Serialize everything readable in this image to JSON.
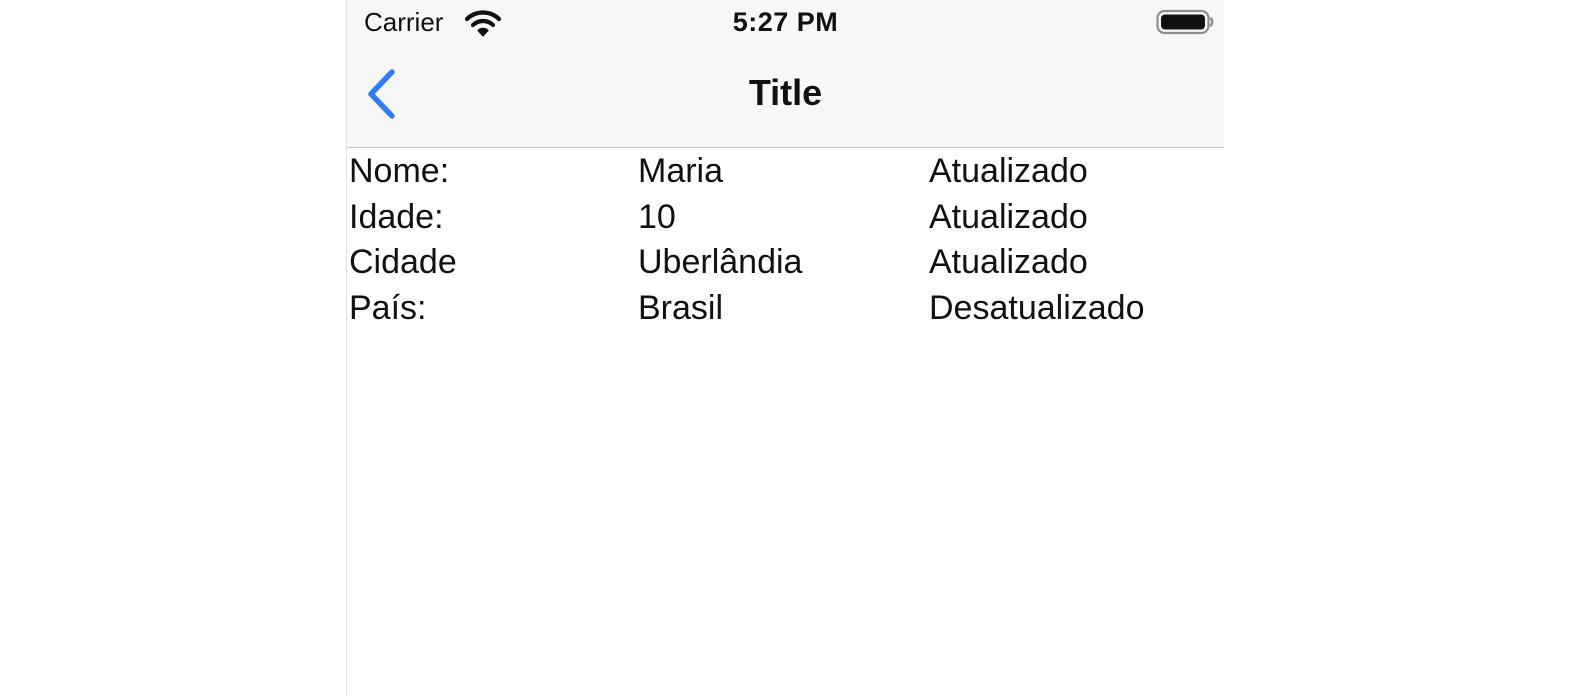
{
  "status_bar": {
    "carrier": "Carrier",
    "time": "5:27 PM",
    "wifi_icon": "wifi-icon",
    "battery_icon": "battery-full-icon"
  },
  "nav_bar": {
    "title": "Title",
    "back_icon": "chevron-left-icon",
    "accent_color": "#2f7cf6",
    "background_color": "#f7f7f7"
  },
  "rows": [
    {
      "label": "Nome:",
      "value": "Maria",
      "status": "Atualizado"
    },
    {
      "label": "Idade:",
      "value": "10",
      "status": "Atualizado"
    },
    {
      "label": "Cidade",
      "value": "Uberlândia",
      "status": "Atualizado"
    },
    {
      "label": "País:",
      "value": "Brasil",
      "status": "Desatualizado"
    }
  ]
}
